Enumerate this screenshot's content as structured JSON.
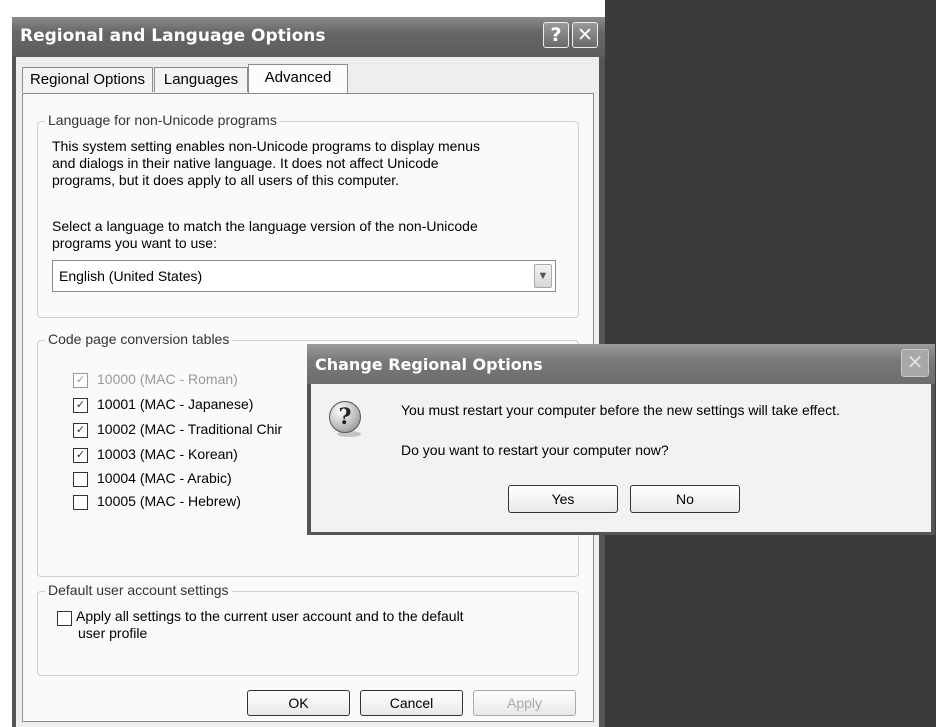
{
  "window": {
    "title": "Regional and Language Options",
    "help_symbol": "?",
    "close_symbol": "✕"
  },
  "tabs": [
    {
      "label": "Regional Options"
    },
    {
      "label": "Languages"
    },
    {
      "label": "Advanced",
      "active": true
    }
  ],
  "nonunicode": {
    "group_label": "Language for non-Unicode programs",
    "description_lines": [
      "This system setting enables non-Unicode programs to display menus",
      "and dialogs in their native language. It does not affect Unicode",
      "programs, but it does apply to all users of this computer."
    ],
    "prompt_lines": [
      "Select a language to match the language version of the non-Unicode",
      "programs you want to use:"
    ],
    "selected_language": "English (United States)"
  },
  "codepages": {
    "group_label": "Code page conversion tables",
    "items": [
      {
        "label": "10000 (MAC - Roman)",
        "checked": true,
        "disabled": true
      },
      {
        "label": "10001 (MAC - Japanese)",
        "checked": true,
        "disabled": false
      },
      {
        "label": "10002 (MAC - Traditional Chir",
        "checked": true,
        "disabled": false
      },
      {
        "label": "10003 (MAC - Korean)",
        "checked": true,
        "disabled": false
      },
      {
        "label": "10004 (MAC - Arabic)",
        "checked": false,
        "disabled": false
      },
      {
        "label": "10005 (MAC - Hebrew)",
        "checked": false,
        "disabled": false
      }
    ]
  },
  "default_user": {
    "group_label": "Default user account settings",
    "checkbox_lines": [
      "Apply all settings to the current user account and to the default",
      "user profile"
    ],
    "checked": false
  },
  "buttons": {
    "ok": "OK",
    "cancel": "Cancel",
    "apply": "Apply"
  },
  "message_box": {
    "title": "Change Regional Options",
    "icon": "question-icon",
    "icon_symbol": "?",
    "close_symbol": "✕",
    "line1": "You must restart your computer before the new settings will take effect.",
    "line2": "Do you want to restart your computer now?",
    "yes": "Yes",
    "no": "No"
  },
  "colors": {
    "titlebar": "#666666",
    "background_right": "#3a3a3a"
  }
}
